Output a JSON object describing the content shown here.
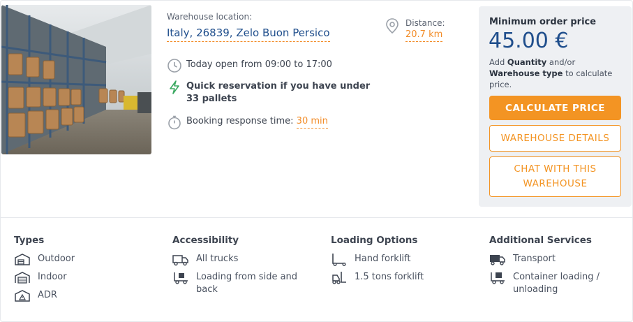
{
  "location": {
    "label": "Warehouse location:",
    "value": "Italy, 26839, Zelo Buon Persico"
  },
  "distance": {
    "label": "Distance:",
    "value": "20.7 km"
  },
  "features": {
    "hours": "Today open from 09:00 to 17:00",
    "quick_reservation": "Quick reservation if you have under 33 pallets",
    "response_label": "Booking response time:",
    "response_value": "30 min"
  },
  "pricing": {
    "label": "Minimum order price",
    "value": "45.00 €",
    "note_prefix": "Add",
    "note_quantity": "Quantity",
    "note_middle": "and/or",
    "note_type": "Warehouse type",
    "note_suffix": "to calculate price.",
    "calculate_button": "CALCULATE PRICE",
    "details_button": "WAREHOUSE DETAILS",
    "chat_button": "CHAT WITH THIS WAREHOUSE"
  },
  "colors": {
    "accent": "#f39423",
    "link": "#1f4e8c",
    "panel": "#eef0f3"
  },
  "sections": {
    "types": {
      "title": "Types",
      "items": [
        {
          "icon": "outdoor-warehouse-icon",
          "label": "Outdoor"
        },
        {
          "icon": "indoor-warehouse-icon",
          "label": "Indoor"
        },
        {
          "icon": "adr-warning-icon",
          "label": "ADR"
        }
      ]
    },
    "accessibility": {
      "title": "Accessibility",
      "items": [
        {
          "icon": "truck-icon",
          "label": "All trucks"
        },
        {
          "icon": "side-loading-icon",
          "label": "Loading from side and back"
        }
      ]
    },
    "loading": {
      "title": "Loading Options",
      "items": [
        {
          "icon": "hand-forklift-icon",
          "label": "Hand forklift"
        },
        {
          "icon": "forklift-icon",
          "label": "1.5 tons forklift"
        }
      ]
    },
    "services": {
      "title": "Additional Services",
      "items": [
        {
          "icon": "transport-truck-icon",
          "label": "Transport"
        },
        {
          "icon": "container-loading-icon",
          "label": "Container loading / unloading"
        }
      ]
    }
  }
}
